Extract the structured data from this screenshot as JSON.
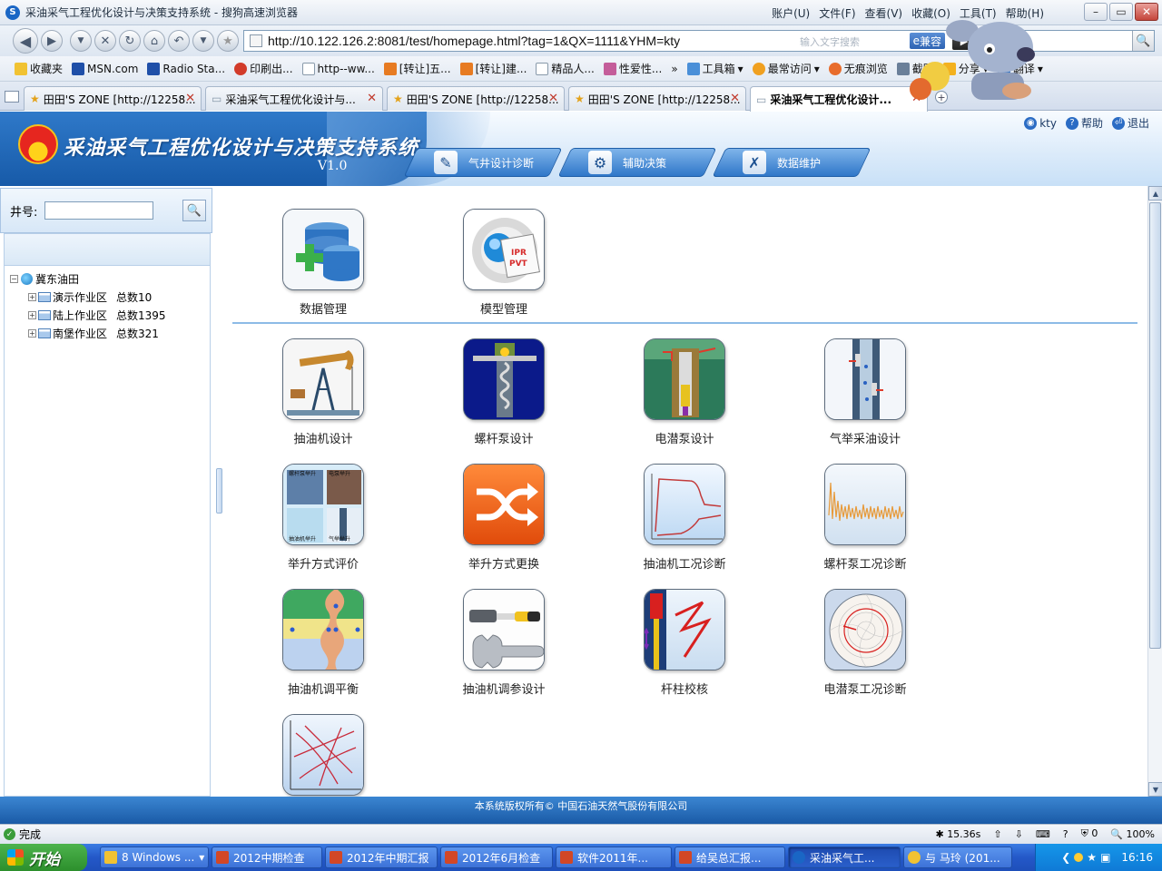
{
  "browser": {
    "window_title": "采油采气工程优化设计与决策支持系统 - 搜狗高速浏览器",
    "menus": [
      "账户(U)",
      "文件(F)",
      "查看(V)",
      "收藏(O)",
      "工具(T)",
      "帮助(H)"
    ],
    "address_url": "http://10.122.126.2:8081/test/homepage.html?tag=1&QX=1111&YHM=kty",
    "address_hint": "输入文字搜索",
    "compat_label": "兼容",
    "favorites": [
      "收藏夹",
      "MSN.com",
      "Radio Sta...",
      "印刷出...",
      "http--ww...",
      "[转让]五...",
      "[转让]建...",
      "精品人...",
      "性爱性...",
      "工具箱",
      "最常访问",
      "无痕浏览",
      "截图",
      "分享",
      "翻译"
    ],
    "tabs": [
      {
        "label": "田田'S ZONE [http://12258..."
      },
      {
        "label": "采油采气工程优化设计与..."
      },
      {
        "label": "田田'S ZONE [http://12258..."
      },
      {
        "label": "田田'S ZONE [http://12258..."
      },
      {
        "label": "采油采气工程优化设计..."
      }
    ]
  },
  "header": {
    "system_title": "采油采气工程优化设计与决策支持系统",
    "version": "V1.0",
    "user": "kty",
    "help": "帮助",
    "logout": "退出",
    "nav": [
      "气井设计诊断",
      "辅助决策",
      "数据维护"
    ]
  },
  "sidebar": {
    "well_label": "井号:",
    "well_value": "",
    "tree_root": "冀东油田",
    "tree_items": [
      {
        "name": "演示作业区",
        "count": "总数10"
      },
      {
        "name": "陆上作业区",
        "count": "总数1395"
      },
      {
        "name": "南堡作业区",
        "count": "总数321"
      }
    ]
  },
  "modules": {
    "top": [
      {
        "label": "数据管理",
        "icon": "database-add-icon"
      },
      {
        "label": "模型管理",
        "icon": "ipr-pvt-model-icon"
      }
    ],
    "grid": [
      {
        "label": "抽油机设计",
        "icon": "pump-jack-icon"
      },
      {
        "label": "螺杆泵设计",
        "icon": "screw-pump-icon"
      },
      {
        "label": "电潜泵设计",
        "icon": "esp-icon"
      },
      {
        "label": "气举采油设计",
        "icon": "gas-lift-icon"
      },
      {
        "label": "举升方式评价",
        "icon": "lift-evaluation-icon"
      },
      {
        "label": "举升方式更换",
        "icon": "shuffle-icon"
      },
      {
        "label": "抽油机工况诊断",
        "icon": "dynamometer-card-icon"
      },
      {
        "label": "螺杆泵工况诊断",
        "icon": "waveform-icon"
      },
      {
        "label": "抽油机调平衡",
        "icon": "balance-icon"
      },
      {
        "label": "抽油机调参设计",
        "icon": "hammer-wrench-icon"
      },
      {
        "label": "杆柱校核",
        "icon": "rod-check-icon"
      },
      {
        "label": "电潜泵工况诊断",
        "icon": "ammeter-chart-icon"
      },
      {
        "label": "",
        "icon": "nomogram-chart-icon"
      }
    ],
    "tile_texts": {
      "ipr": "IPR",
      "pvt": "PVT",
      "lift_1": "螺杆泵举升",
      "lift_2": "电泵举升",
      "lift_3": "抽油机举升",
      "lift_4": "气举举升"
    }
  },
  "footer": {
    "copyright": "本系统版权所有© 中国石油天然气股份有限公司"
  },
  "status": {
    "done": "完成",
    "speed": "15.36s",
    "blocked": "0",
    "zoom": "100%"
  },
  "taskbar": {
    "start": "开始",
    "tasks": [
      "8 Windows ...",
      "2012中期检查",
      "2012年中期汇报",
      "2012年6月检查",
      "软件2011年...",
      "给吴总汇报...",
      "采油采气工...",
      "与 马玲 (201..."
    ],
    "clock": "16:16"
  },
  "colors": {
    "header_blue": "#175aa8",
    "divider": "#8dbbe6",
    "footer_blue": "#1a5aa6"
  }
}
